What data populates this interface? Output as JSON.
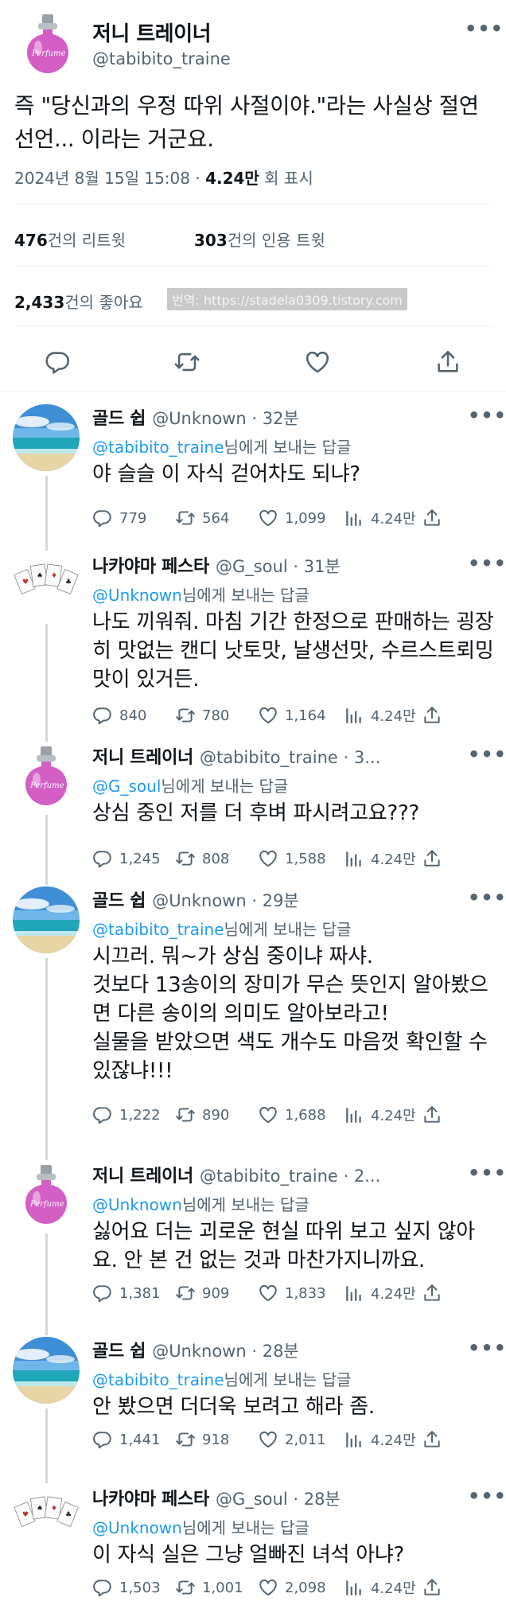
{
  "main_tweet": {
    "author_name": "저니 트레이너",
    "author_handle": "@tabibito_traine",
    "avatar_text": "Perfume",
    "text": "즉 \"당신과의 우정 따위 사절이야.\"라는 사실상 절연 선언... 이라는 거군요.",
    "timestamp": "2024년 8월 15일 15:08",
    "views": "4.24만",
    "views_suffix": "회 표시",
    "retweets": "476",
    "retweets_label": "건의 리트윗",
    "quotes": "303",
    "quotes_label": "건의 인용 트윗",
    "likes": "2,433",
    "likes_label": "건의 좋아요",
    "watermark": "번역: https://stadela0309.tistory.com"
  },
  "replies": [
    {
      "name": "골드 쉽",
      "handle": "@Unknown",
      "time": "32분",
      "replying_to": "@tabibito_traine",
      "replying_suffix": "님에게 보내는 답글",
      "text": "야 슬슬 이 자식 걷어차도 되냐?",
      "replies": "779",
      "retweets": "564",
      "likes": "1,099",
      "views": "4.24만"
    },
    {
      "name": "나카야마 페스타",
      "handle": "@G_soul",
      "time": "31분",
      "replying_to": "@Unknown",
      "replying_suffix": "님에게 보내는 답글",
      "text": "나도 끼워줘. 마침 기간 한정으로 판매하는 굉장히 맛없는 캔디 낫토맛, 날생선맛, 수르스트뢰밍맛이 있거든.",
      "replies": "840",
      "retweets": "780",
      "likes": "1,164",
      "views": "4.24만"
    },
    {
      "name": "저니 트레이너",
      "handle": "@tabibito_traine",
      "time": "3...",
      "replying_to": "@G_soul",
      "replying_suffix": "님에게 보내는 답글",
      "text": "상심 중인 저를 더 후벼 파시려고요???",
      "avatar_text": "Perfume",
      "replies": "1,245",
      "retweets": "808",
      "likes": "1,588",
      "views": "4.24만"
    },
    {
      "name": "골드 쉽",
      "handle": "@Unknown",
      "time": "29분",
      "replying_to": "@tabibito_traine",
      "replying_suffix": "님에게 보내는 답글",
      "text": "시끄러. 뭐~가 상심 중이냐 짜샤.\n것보다 13송이의 장미가 무슨 뜻인지 알아봤으면 다른 송이의 의미도 알아보라고!\n실물을 받았으면 색도 개수도 마음껏 확인할 수 있잖냐!!!",
      "replies": "1,222",
      "retweets": "890",
      "likes": "1,688",
      "views": "4.24만"
    },
    {
      "name": "저니 트레이너",
      "handle": "@tabibito_traine",
      "time": "2...",
      "replying_to": "@Unknown",
      "replying_suffix": "님에게 보내는 답글",
      "text": "싫어요 더는 괴로운 현실 따위 보고 싶지 않아요. 안 본 건 없는 것과 마찬가지니까요.",
      "avatar_text": "Perfume",
      "replies": "1,381",
      "retweets": "909",
      "likes": "1,833",
      "views": "4.24만"
    },
    {
      "name": "골드 쉽",
      "handle": "@Unknown",
      "time": "28분",
      "replying_to": "@tabibito_traine",
      "replying_suffix": "님에게 보내는 답글",
      "text": "안 봤으면 더더욱 보려고 해라 좀.",
      "replies": "1,441",
      "retweets": "918",
      "likes": "2,011",
      "views": "4.24만"
    },
    {
      "name": "나카야마 페스타",
      "handle": "@G_soul",
      "time": "28분",
      "replying_to": "@Unknown",
      "replying_suffix": "님에게 보내는 답글",
      "text": "이 자식 실은 그냥 얼빠진 녀석 아냐?",
      "replies": "1,503",
      "retweets": "1,001",
      "likes": "2,098",
      "views": "4.24만"
    }
  ],
  "colors": {
    "text": "#0f1419",
    "secondary": "#536471",
    "mention": "#1d9bf0",
    "thread_line": "#cfd9de",
    "divider": "#eff3f4",
    "perfume_pink": "#d35fc4"
  },
  "icons": [
    "more-icon",
    "reply-icon",
    "retweet-icon",
    "like-icon",
    "views-icon",
    "share-icon"
  ]
}
